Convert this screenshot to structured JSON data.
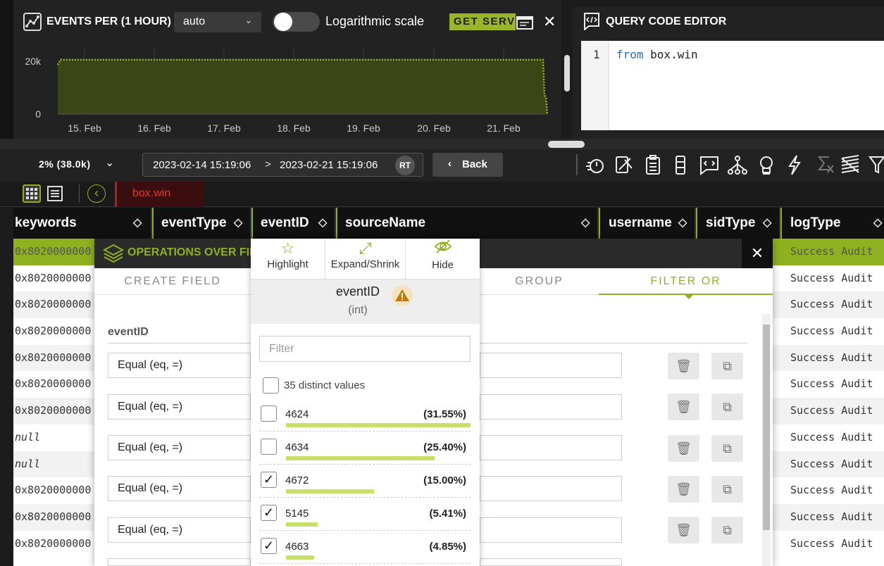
{
  "chart_panel": {
    "title": "EVENTS PER (1 HOUR)",
    "interval_value": "auto",
    "log_scale_label": "Logarithmic scale",
    "get_button": "GET SERVE",
    "close": "✕"
  },
  "chart_data": {
    "type": "area",
    "x": [
      "15. Feb",
      "16. Feb",
      "17. Feb",
      "18. Feb",
      "19. Feb",
      "20. Feb",
      "21. Feb"
    ],
    "y_ticks": [
      "20k",
      "0"
    ],
    "ylim": [
      0,
      25000
    ],
    "series_color": "#99b52a",
    "approx_value": 20500
  },
  "query_editor": {
    "title": "QUERY CODE EDITOR",
    "line_number": "1",
    "code_keyword": "from",
    "code_rest": " box.win"
  },
  "toolbar": {
    "sample_label": "2% (38.0k)",
    "date_from": "2023-02-14 15:19:06",
    "date_sep": ">",
    "date_to": "2023-02-21 15:19:06",
    "rt_badge": "RT",
    "back_label": "Back"
  },
  "tabs": {
    "active_tab": "box.win"
  },
  "grid": {
    "columns": [
      "keywords",
      "eventType",
      "eventID",
      "sourceName",
      "username",
      "sidType",
      "logType"
    ],
    "keywords_values": [
      "0x8020000000",
      "0x8020000000",
      "0x8020000000",
      "0x8020000000",
      "0x8020000000",
      "0x8020000000",
      "0x8020000000",
      "null",
      "null",
      "0x8020000000",
      "0x8020000000",
      "0x8020000000"
    ],
    "logtype_values": [
      "Success Audit",
      "Success Audit",
      "Success Audit",
      "Success Audit",
      "Success Audit",
      "Success Audit",
      "Success Audit",
      "Success Audit",
      "Success Audit",
      "Success Audit",
      "Success Audit",
      "Success Audit"
    ]
  },
  "operations_modal": {
    "title": "OPERATIONS OVER FIE",
    "tabs": [
      "CREATE FIELD",
      "GROUP",
      "FILTER OR"
    ],
    "field_label": "eventID",
    "operator_values": [
      "Equal (eq, =)",
      "Equal (eq, =)",
      "Equal (eq, =)",
      "Equal (eq, =)",
      "Equal (eq, =)"
    ]
  },
  "field_popup": {
    "actions": [
      "Highlight",
      "Expand/Shrink",
      "Hide"
    ],
    "field_name": "eventID",
    "field_type": "(int)",
    "filter_placeholder": "Filter",
    "distinct_label": "35 distinct values",
    "values": [
      {
        "label": "4624",
        "pct": "(31.55%)",
        "fraction": 0.3155,
        "checked": false
      },
      {
        "label": "4634",
        "pct": "(25.40%)",
        "fraction": 0.254,
        "checked": false
      },
      {
        "label": "4672",
        "pct": "(15.00%)",
        "fraction": 0.15,
        "checked": true
      },
      {
        "label": "5145",
        "pct": "(5.41%)",
        "fraction": 0.0541,
        "checked": true
      },
      {
        "label": "4663",
        "pct": "(4.85%)",
        "fraction": 0.0485,
        "checked": true
      }
    ]
  }
}
